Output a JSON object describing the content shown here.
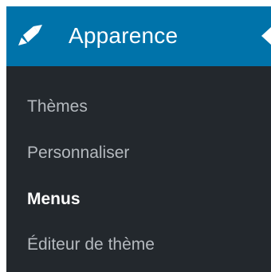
{
  "menu": {
    "title": "Apparence",
    "icon": "brush-icon",
    "collapse_icon": "caret-left-icon",
    "colors": {
      "header_bg": "#0073aa",
      "submenu_bg": "#23282d",
      "item_text": "#b4b9be",
      "current_text": "#ffffff"
    },
    "items": [
      {
        "label": "Thèmes",
        "current": false
      },
      {
        "label": "Personnaliser",
        "current": false
      },
      {
        "label": "Menus",
        "current": true
      },
      {
        "label": "Éditeur de thème",
        "current": false
      }
    ]
  }
}
